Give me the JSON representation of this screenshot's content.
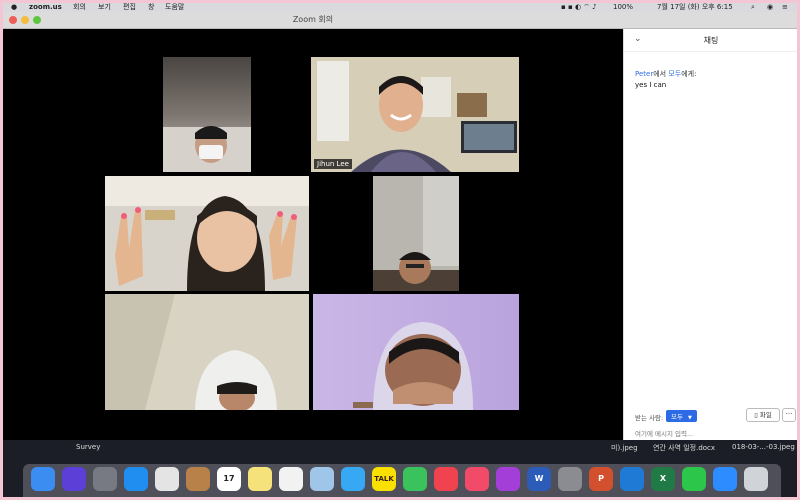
{
  "menubar": {
    "app_name": "zoom.us",
    "items": [
      "회의",
      "보기",
      "편집",
      "창",
      "도움말"
    ],
    "battery": "100%",
    "clock": "7월 17일 (화) 오후 6:15"
  },
  "window": {
    "title": "Zoom 회의"
  },
  "participants": [
    {
      "name": ""
    },
    {
      "name": "Jihun Lee"
    },
    {
      "name": ""
    },
    {
      "name": ""
    },
    {
      "name": ""
    },
    {
      "name": ""
    }
  ],
  "chat": {
    "title": "채팅",
    "message": {
      "sender": "Peter",
      "middle": "에서 ",
      "recipient": "모두",
      "suffix": "에게:",
      "text": "yes I can"
    },
    "to_label": "받는 사람:",
    "to_value": "모두",
    "file_button": "파일",
    "more_button": "···",
    "input_placeholder": "여기에 메시지 입력..."
  },
  "desktop": {
    "left_label": "Survey",
    "files": [
      "미).jpeg",
      "연간 사역 일정.docx",
      "018-03-...-03.jpeg"
    ]
  },
  "dock": {
    "apps": [
      {
        "name": "Finder",
        "color": "#3b8df2"
      },
      {
        "name": "Siri",
        "color": "#5c3fd6"
      },
      {
        "name": "Launchpad",
        "color": "#777a82"
      },
      {
        "name": "Safari",
        "color": "#1f8ef0"
      },
      {
        "name": "Chrome",
        "color": "#e4e4e4"
      },
      {
        "name": "Notefile",
        "color": "#b8814a"
      },
      {
        "name": "Calendar",
        "color": "#ffffff"
      },
      {
        "name": "Notes",
        "color": "#f6e27a"
      },
      {
        "name": "Reminders",
        "color": "#f2f2f2"
      },
      {
        "name": "Preview",
        "color": "#9fc6e8"
      },
      {
        "name": "Messages",
        "color": "#37a8f4"
      },
      {
        "name": "KakaoTalk",
        "color": "#f9e000"
      },
      {
        "name": "FaceTime",
        "color": "#3ac35c"
      },
      {
        "name": "News",
        "color": "#f0424f"
      },
      {
        "name": "Music",
        "color": "#f24b6a"
      },
      {
        "name": "Podcasts",
        "color": "#a33fd8"
      },
      {
        "name": "Word",
        "color": "#2b5cb8"
      },
      {
        "name": "System Preferences",
        "color": "#8a8c91"
      },
      {
        "name": "PowerPoint",
        "color": "#d2502e"
      },
      {
        "name": "Outlook",
        "color": "#1f7ad6"
      },
      {
        "name": "Excel",
        "color": "#1f7a45"
      },
      {
        "name": "WhatsApp",
        "color": "#2cc64a"
      },
      {
        "name": "Zoom",
        "color": "#2d8cff"
      },
      {
        "name": "Trash",
        "color": "#d0d3d8"
      }
    ],
    "labels": {
      "calendar_day": "17",
      "kakao": "TALK",
      "word": "W",
      "powerpoint": "P",
      "excel": "X"
    }
  }
}
